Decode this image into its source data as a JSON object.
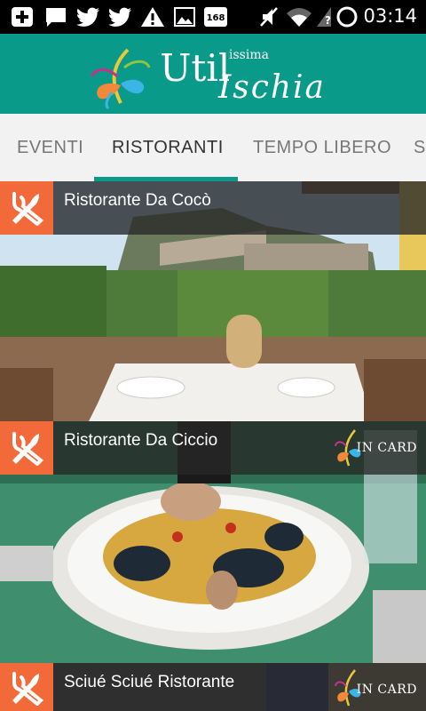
{
  "status_bar": {
    "time": "03:14",
    "icons": [
      "add-icon",
      "chat-icon",
      "twitter-icon",
      "twitter-icon",
      "warning-icon",
      "image-icon",
      "calendar-168-icon",
      "mute-icon",
      "wifi-icon",
      "signal-unknown-icon",
      "circle-icon"
    ],
    "calendar_number": "168"
  },
  "header": {
    "logo_util": "Util",
    "logo_issima": "issima",
    "logo_ischia": "Ischia"
  },
  "tabs": [
    {
      "label": "EVENTI",
      "active": false
    },
    {
      "label": "RISTORANTI",
      "active": true
    },
    {
      "label": "TEMPO LIBERO",
      "active": false
    },
    {
      "label": "S",
      "active": false
    }
  ],
  "restaurants": [
    {
      "name": "Ristorante Da Cocò",
      "in_card": false,
      "icon": "fork-knife-icon"
    },
    {
      "name": "Ristorante Da Ciccio",
      "in_card": true,
      "in_card_label": "IN CARD",
      "icon": "fork-knife-icon"
    },
    {
      "name": "Sciué Sciué Ristorante",
      "in_card": true,
      "in_card_label": "IN CARD",
      "icon": "fork-knife-icon"
    }
  ],
  "colors": {
    "accent": "#0a9a8a",
    "icon_bg": "#f26a3a"
  }
}
